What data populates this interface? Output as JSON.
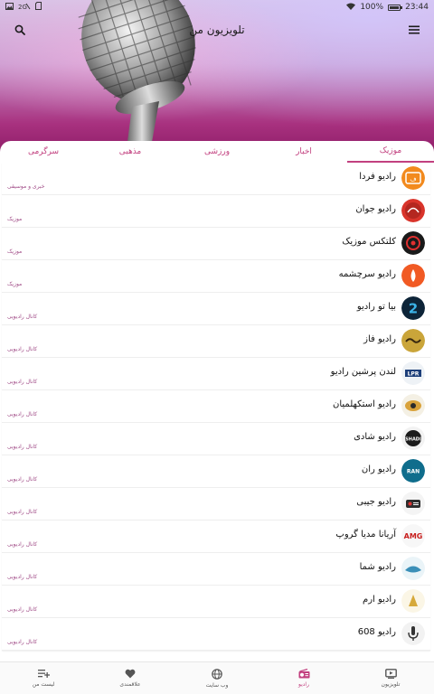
{
  "status_bar": {
    "time": "23:44",
    "battery_text": "100%",
    "battery_level": 1.0,
    "icons": [
      "gallery-icon",
      "dual-sim-icon",
      "sd-card-icon",
      "wifi-icon",
      "battery-icon"
    ]
  },
  "toolbar": {
    "title": "تلویزیون من"
  },
  "tabs": [
    {
      "label": "موزیک",
      "active": true
    },
    {
      "label": "اخبار",
      "active": false
    },
    {
      "label": "ورزشی",
      "active": false
    },
    {
      "label": "مذهبی",
      "active": false
    },
    {
      "label": "سرگرمی",
      "active": false
    }
  ],
  "stations": [
    {
      "name": "رادیو فردا",
      "category": "خبری و موسیقی",
      "logo": "farda"
    },
    {
      "name": "رادیو جوان",
      "category": "موزیک",
      "logo": "javan"
    },
    {
      "name": "کلتکس موزیک",
      "category": "موزیک",
      "logo": "kltx"
    },
    {
      "name": "رادیو سرچشمه",
      "category": "موزیک",
      "logo": "sarcheshmeh"
    },
    {
      "name": "بیا تو رادیو",
      "category": "کانال رادیویی",
      "logo": "biato"
    },
    {
      "name": "رادیو فاز",
      "category": "کانال رادیویی",
      "logo": "faz"
    },
    {
      "name": "لندن پرشین رادیو",
      "category": "کانال رادیویی",
      "logo": "lpr"
    },
    {
      "name": "رادیو استکهلمیان",
      "category": "کانال رادیویی",
      "logo": "stockholm"
    },
    {
      "name": "رادیو شادی",
      "category": "کانال رادیویی",
      "logo": "shadi"
    },
    {
      "name": "رادیو ران",
      "category": "کانال رادیویی",
      "logo": "ran"
    },
    {
      "name": "رادیو جیبی",
      "category": "کانال رادیویی",
      "logo": "jibi"
    },
    {
      "name": "آریانا مدیا گروپ",
      "category": "کانال رادیویی",
      "logo": "amg"
    },
    {
      "name": "رادیو شما",
      "category": "کانال رادیویی",
      "logo": "shoma"
    },
    {
      "name": "رادیو ارم",
      "category": "کانال رادیویی",
      "logo": "eram"
    },
    {
      "name": "رادیو 608",
      "category": "کانال رادیویی",
      "logo": "608"
    }
  ],
  "bottom_nav": [
    {
      "label": "تلویزیون",
      "icon": "tv-icon",
      "active": false
    },
    {
      "label": "رادیو",
      "icon": "radio-icon",
      "active": true
    },
    {
      "label": "وب سایت",
      "icon": "globe-icon",
      "active": false
    },
    {
      "label": "علاقمندی",
      "icon": "heart-icon",
      "active": false
    },
    {
      "label": "لیست من",
      "icon": "playlist-add-icon",
      "active": false
    }
  ],
  "colors": {
    "accent": "#c2407f",
    "hero_dark": "#8a1a64"
  }
}
